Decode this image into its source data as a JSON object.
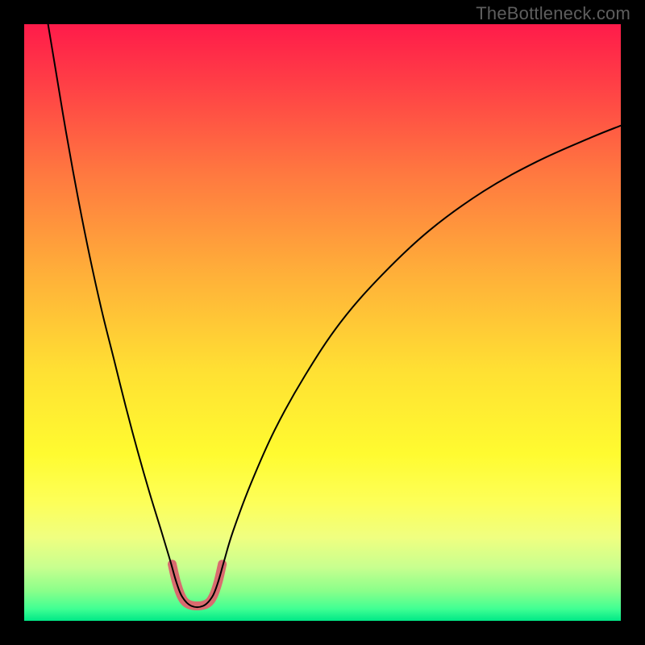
{
  "watermark": "TheBottleneck.com",
  "chart_data": {
    "type": "line",
    "title": "",
    "xlabel": "",
    "ylabel": "",
    "xlim": [
      0,
      100
    ],
    "ylim": [
      0,
      100
    ],
    "gradient_stops": [
      {
        "offset": 0.0,
        "color": "#ff1b4a"
      },
      {
        "offset": 0.1,
        "color": "#ff3f46"
      },
      {
        "offset": 0.25,
        "color": "#ff7840"
      },
      {
        "offset": 0.42,
        "color": "#ffb039"
      },
      {
        "offset": 0.58,
        "color": "#ffe033"
      },
      {
        "offset": 0.72,
        "color": "#fffb30"
      },
      {
        "offset": 0.8,
        "color": "#fdff58"
      },
      {
        "offset": 0.86,
        "color": "#f0ff80"
      },
      {
        "offset": 0.91,
        "color": "#c8ff8f"
      },
      {
        "offset": 0.95,
        "color": "#8aff8a"
      },
      {
        "offset": 0.98,
        "color": "#40ff93"
      },
      {
        "offset": 1.0,
        "color": "#00e887"
      }
    ],
    "series": [
      {
        "name": "bottleneck-curve",
        "stroke": "#000000",
        "stroke_width": 2,
        "points": [
          {
            "x": 4.0,
            "y": 100.0
          },
          {
            "x": 5.0,
            "y": 94.0
          },
          {
            "x": 7.0,
            "y": 82.0
          },
          {
            "x": 9.0,
            "y": 71.0
          },
          {
            "x": 11.0,
            "y": 61.0
          },
          {
            "x": 13.0,
            "y": 52.0
          },
          {
            "x": 15.0,
            "y": 44.0
          },
          {
            "x": 17.0,
            "y": 36.0
          },
          {
            "x": 19.0,
            "y": 28.5
          },
          {
            "x": 21.0,
            "y": 21.5
          },
          {
            "x": 23.0,
            "y": 15.0
          },
          {
            "x": 24.5,
            "y": 10.0
          },
          {
            "x": 25.5,
            "y": 6.5
          },
          {
            "x": 26.5,
            "y": 4.0
          },
          {
            "x": 28.0,
            "y": 2.5
          },
          {
            "x": 30.0,
            "y": 2.5
          },
          {
            "x": 31.5,
            "y": 4.0
          },
          {
            "x": 32.5,
            "y": 6.5
          },
          {
            "x": 33.5,
            "y": 10.0
          },
          {
            "x": 35.0,
            "y": 15.0
          },
          {
            "x": 38.0,
            "y": 23.0
          },
          {
            "x": 42.0,
            "y": 32.0
          },
          {
            "x": 47.0,
            "y": 41.0
          },
          {
            "x": 53.0,
            "y": 50.0
          },
          {
            "x": 60.0,
            "y": 58.0
          },
          {
            "x": 68.0,
            "y": 65.5
          },
          {
            "x": 77.0,
            "y": 72.0
          },
          {
            "x": 86.0,
            "y": 77.0
          },
          {
            "x": 95.0,
            "y": 81.0
          },
          {
            "x": 100.0,
            "y": 83.0
          }
        ]
      },
      {
        "name": "notch-highlight",
        "stroke": "#d96b6f",
        "stroke_width": 11,
        "points": [
          {
            "x": 24.8,
            "y": 9.5
          },
          {
            "x": 25.5,
            "y": 6.5
          },
          {
            "x": 26.3,
            "y": 4.2
          },
          {
            "x": 27.3,
            "y": 2.9
          },
          {
            "x": 29.0,
            "y": 2.5
          },
          {
            "x": 30.7,
            "y": 2.9
          },
          {
            "x": 31.7,
            "y": 4.2
          },
          {
            "x": 32.5,
            "y": 6.5
          },
          {
            "x": 33.2,
            "y": 9.5
          }
        ]
      }
    ],
    "minimum_x": 29.0
  }
}
